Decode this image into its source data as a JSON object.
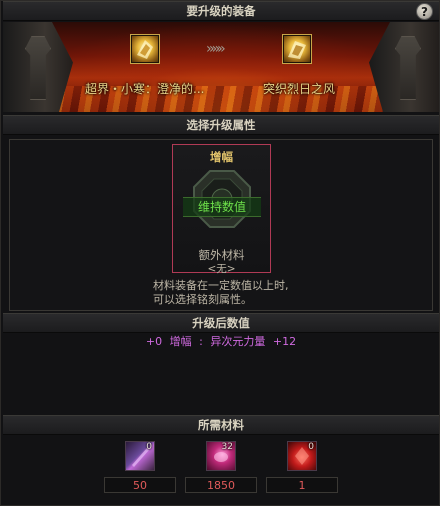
{
  "header": {
    "title": "要升级的装备",
    "help_label": "?"
  },
  "banner": {
    "source_item": "超界・小寒：澄净的...",
    "target_item": "突织烈日之风",
    "arrows": "»»»"
  },
  "attribute_section": {
    "title": "选择升级属性",
    "card": {
      "title": "增幅",
      "label": "维持数值",
      "extra_material": "额外材料",
      "extra_none": "<无>"
    },
    "description_line1": "材料装备在一定数值以上时,",
    "description_line2": "可以选择铭刻属性。"
  },
  "after_section": {
    "title": "升级后数值",
    "line": {
      "prefix": "+0",
      "stat": "增幅",
      "separator": ":",
      "attribute": "异次元力量",
      "value": "+12"
    }
  },
  "materials_section": {
    "title": "所需材料",
    "items": [
      {
        "count": "0",
        "value": "50"
      },
      {
        "count": "32",
        "value": "1850"
      },
      {
        "count": "0",
        "value": "1"
      }
    ]
  },
  "colors": {
    "accent_gold": "#e0c26a",
    "green_label": "#6ee04a",
    "purple_text": "#d06ae0",
    "red_value": "#e05a5a",
    "card_border": "#b03a55"
  },
  "icons": {
    "help": "question-mark-icon",
    "source_item": "gold-equipment-icon",
    "target_item": "gold-equipment-icon",
    "emblem": "octagon-emblem-icon",
    "material_1": "purple-dagger-icon",
    "material_2": "pink-orb-icon",
    "material_3": "red-crystal-icon"
  }
}
